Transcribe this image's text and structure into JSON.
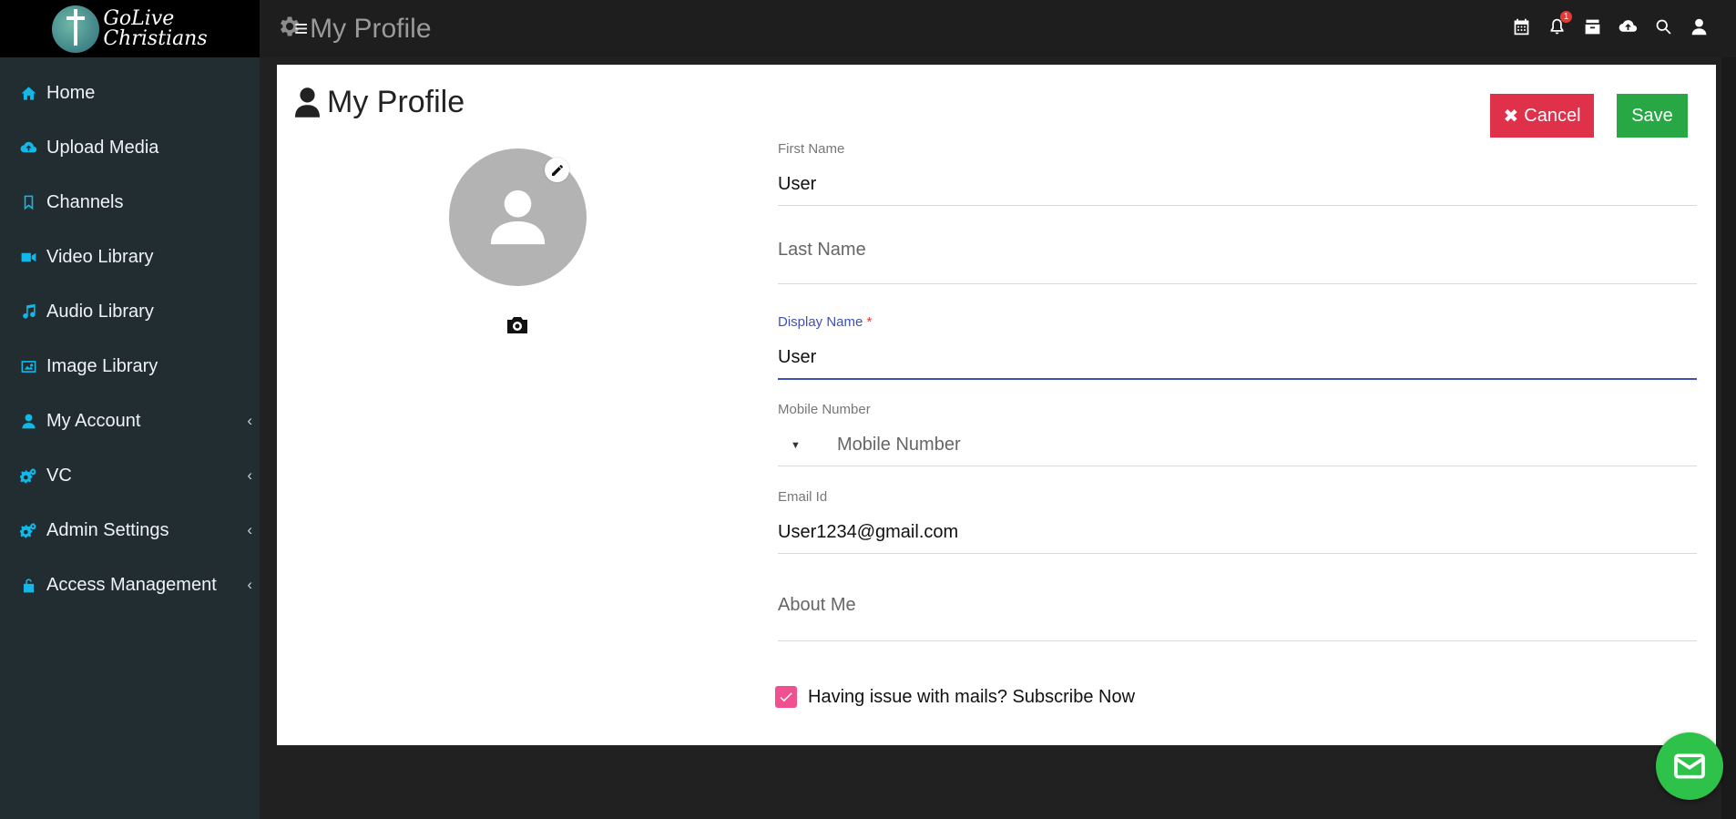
{
  "brand": {
    "line1": "GoLive",
    "line2": "Christians"
  },
  "sidebar": {
    "items": [
      {
        "label": "Home",
        "icon": "home-icon"
      },
      {
        "label": "Upload Media",
        "icon": "cloud-upload-icon"
      },
      {
        "label": "Channels",
        "icon": "bookmark-icon"
      },
      {
        "label": "Video Library",
        "icon": "video-camera-icon"
      },
      {
        "label": "Audio Library",
        "icon": "music-note-icon"
      },
      {
        "label": "Image Library",
        "icon": "image-icon"
      },
      {
        "label": "My Account",
        "icon": "user-icon",
        "expandable": true
      },
      {
        "label": "VC",
        "icon": "gears-icon",
        "expandable": true
      },
      {
        "label": "Admin Settings",
        "icon": "gears-icon",
        "expandable": true
      },
      {
        "label": "Access Management",
        "icon": "lock-icon",
        "expandable": true
      }
    ],
    "chevron": "‹"
  },
  "topbar": {
    "title": "My Profile",
    "notification_count": "1",
    "icons": [
      "calendar-icon",
      "bell-icon",
      "inbox-icon",
      "cloud-upload-icon",
      "search-icon",
      "user-icon"
    ]
  },
  "card": {
    "title": "My Profile",
    "cancel_label": "Cancel",
    "save_label": "Save"
  },
  "form": {
    "first_name": {
      "label": "First Name",
      "value": "User"
    },
    "last_name": {
      "placeholder": "Last Name",
      "value": ""
    },
    "display_name": {
      "label": "Display Name",
      "required_mark": "*",
      "value": "User"
    },
    "mobile": {
      "label": "Mobile Number",
      "placeholder": "Mobile Number",
      "value": ""
    },
    "email": {
      "label": "Email Id",
      "value": "User1234@gmail.com"
    },
    "about": {
      "placeholder": "About Me",
      "value": ""
    },
    "subscribe": {
      "label": "Having issue with mails? Subscribe Now",
      "checked": true
    }
  },
  "colors": {
    "sidebar_bg": "#222d32",
    "sidebar_icon": "#12b8e8",
    "cancel": "#e0314b",
    "save": "#28a745",
    "focus": "#3f51b5",
    "checkbox": "#f0508f",
    "mail_fab": "#2fc24a"
  }
}
